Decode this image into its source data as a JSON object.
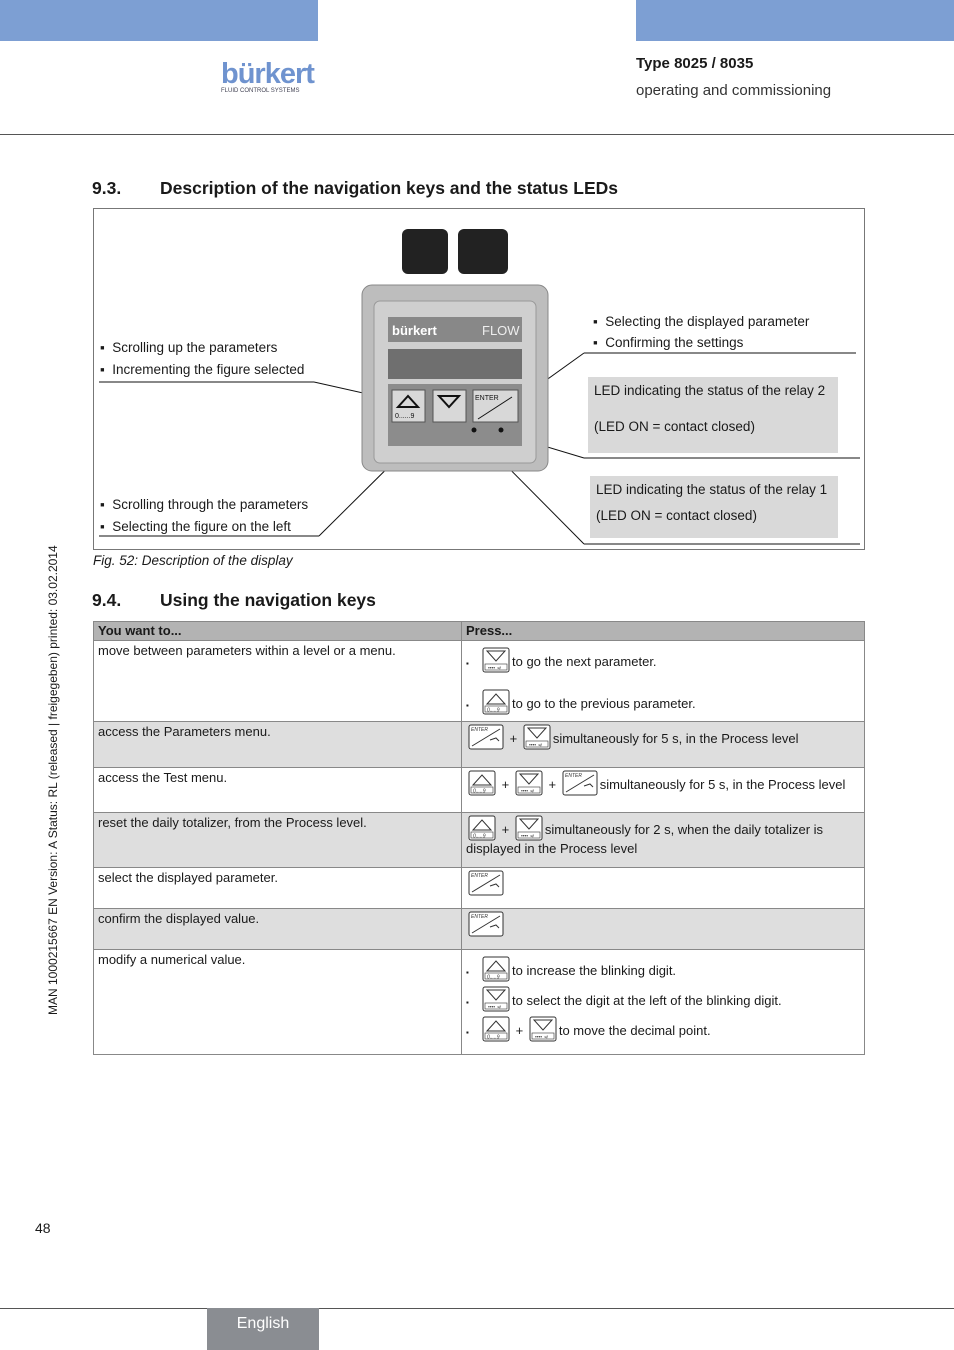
{
  "header": {
    "brand": "bürkert",
    "brand_sub": "FLUID CONTROL SYSTEMS",
    "type": "Type 8025 / 8035",
    "subtitle": "operating and commissioning",
    "accent": "#7d9fd3"
  },
  "section1": {
    "num": "9.3.",
    "title": "Description of the navigation keys and the status LEDs"
  },
  "figure": {
    "device": {
      "brand": "bürkert",
      "label": "FLOW",
      "enter": "ENTER",
      "up_sub": "0......9"
    },
    "left_top": [
      "Scrolling up the parameters",
      "Incrementing the figure selected"
    ],
    "left_bottom": [
      "Scrolling through the parameters",
      "Selecting the figure on the left"
    ],
    "right_top": [
      "Selecting the displayed parameter",
      "Confirming the settings"
    ],
    "led2": [
      "LED indicating the  status of the relay 2",
      "(LED ON = contact closed)"
    ],
    "led1": [
      "LED indicating the status of the relay 1",
      "(LED ON = contact closed)"
    ],
    "caption": "Fig. 52:   Description of the display"
  },
  "section2": {
    "num": "9.4.",
    "title": "Using the navigation keys"
  },
  "table": {
    "headers": [
      "You want to...",
      "Press..."
    ],
    "rows": [
      {
        "want": "move between parameters within a level or a menu.",
        "press": [
          "to go the next parameter.",
          "to go to the previous parameter."
        ]
      },
      {
        "want": "access the Parameters menu.",
        "press": [
          "simultaneously for 5 s, in the Process level"
        ]
      },
      {
        "want": "access the Test menu.",
        "press": [
          "simultaneously for 5 s, in the Process level"
        ]
      },
      {
        "want": "reset the daily totalizer, from the Process level.",
        "press": [
          "simultaneously for 2 s, when the daily totalizer is displayed in the Process level"
        ]
      },
      {
        "want": "select the displayed parameter.",
        "press": []
      },
      {
        "want": "confirm the displayed value.",
        "press": []
      },
      {
        "want": "modify a numerical value.",
        "press": [
          "to increase the blinking digit.",
          "to select the digit at the left of the blinking digit.",
          "to move the decimal point."
        ]
      }
    ]
  },
  "plus": "+",
  "bullet": "▪",
  "page_number": "48",
  "side_text": "MAN  1000215667  EN  Version: A  Status: RL (released | freigegeben)  printed: 03.02.2014",
  "footer": {
    "language": "English"
  }
}
